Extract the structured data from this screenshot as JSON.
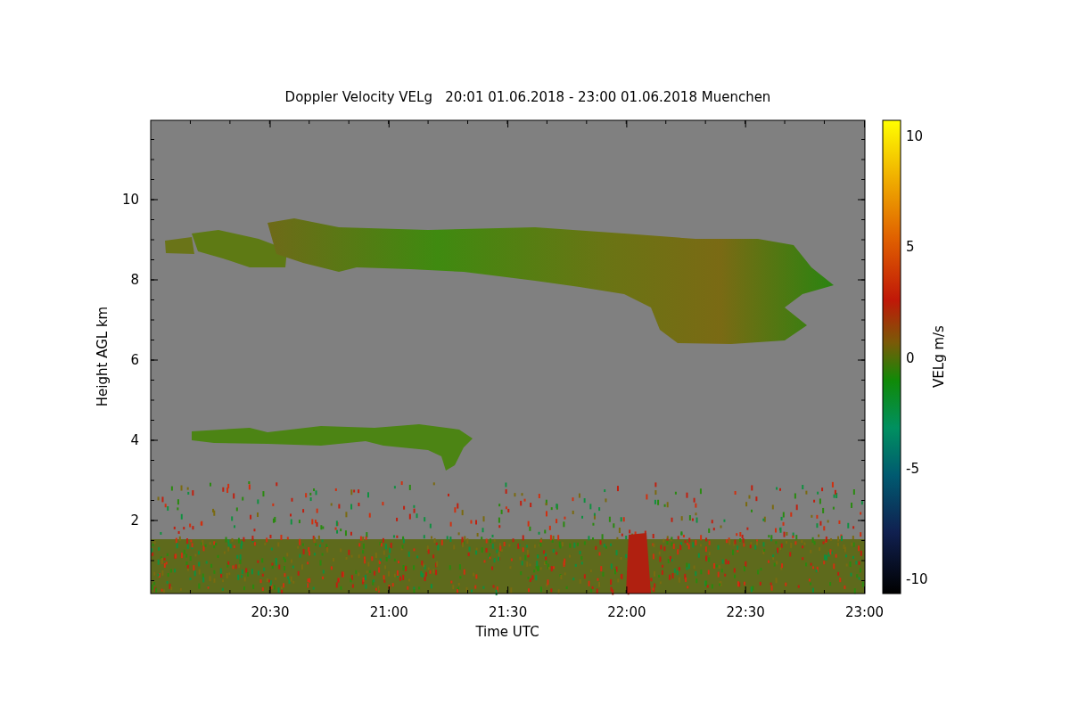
{
  "title": "Doppler Velocity VELg   20:01 01.06.2018 - 23:00 01.06.2018 Muenchen",
  "x_axis": {
    "label": "Time UTC",
    "ticks": [
      "20:30",
      "21:00",
      "21:30",
      "22:00",
      "22:30",
      "23:00"
    ]
  },
  "y_axis": {
    "label": "Height AGL km",
    "ticks": [
      "10",
      "8",
      "6",
      "4",
      "2"
    ]
  },
  "colorbar": {
    "label": "VELg m/s",
    "ticks": [
      "10",
      "5",
      "0",
      "-5",
      "-10"
    ]
  }
}
